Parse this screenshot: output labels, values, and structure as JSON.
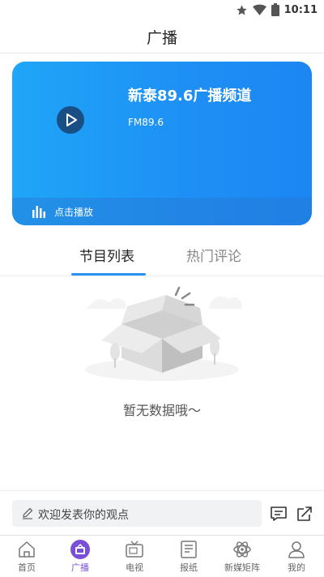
{
  "status_bar": {
    "time": "10:11",
    "icons": [
      "star-icon",
      "wifi-icon",
      "battery-icon"
    ]
  },
  "header": {
    "title": "广播"
  },
  "player": {
    "channel_name": "新泰89.6广播频道",
    "frequency": "FM89.6",
    "play_hint": "点击播放",
    "colors": {
      "gradient_start": "#1fa6f7",
      "gradient_end": "#1c86f2",
      "play_button": "#1a4f86"
    }
  },
  "tabs": [
    {
      "label": "节目列表",
      "active": true
    },
    {
      "label": "热门评论",
      "active": false
    }
  ],
  "empty_state": {
    "message": "暂无数据哦～",
    "icon": "empty-box-illustration"
  },
  "comment_bar": {
    "placeholder": "欢迎发表你的观点",
    "icons": [
      "pencil-icon",
      "comments-icon",
      "share-icon"
    ]
  },
  "bottom_nav": [
    {
      "label": "首页",
      "icon": "home-icon",
      "active": false
    },
    {
      "label": "广播",
      "icon": "broadcast-icon",
      "active": true
    },
    {
      "label": "电视",
      "icon": "tv-icon",
      "active": false
    },
    {
      "label": "报纸",
      "icon": "newspaper-icon",
      "active": false
    },
    {
      "label": "新媒矩阵",
      "icon": "new-media-icon",
      "active": false
    },
    {
      "label": "我的",
      "icon": "user-icon",
      "active": false
    }
  ],
  "accent_color": "#2793f3",
  "nav_active_color": "#7a4fd8"
}
